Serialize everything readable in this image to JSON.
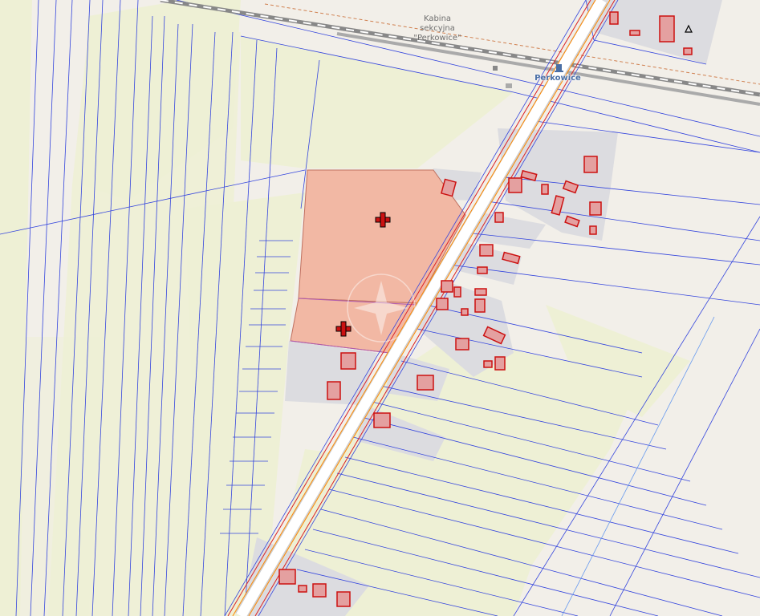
{
  "labels": {
    "kabina": [
      "Kabina",
      "sekcyjna",
      "\"Perkowice\""
    ],
    "station": "Perkowice"
  },
  "icons": {
    "parcel_marker": "cross-marker-icon",
    "watermark": "compass-star-icon",
    "station": "train-station-icon",
    "survey_point": "triangle-point-icon"
  },
  "colors": {
    "background": "#f2efe9",
    "farmland": "#eef0d5",
    "residential": "#dddde0",
    "parcel_lines": "#3344dd",
    "buildings": "#cc1111",
    "road": "#ffffff",
    "utility_lines": "#ff8800",
    "railway": "#777777",
    "selected_parcel": "#f2b8a4"
  }
}
